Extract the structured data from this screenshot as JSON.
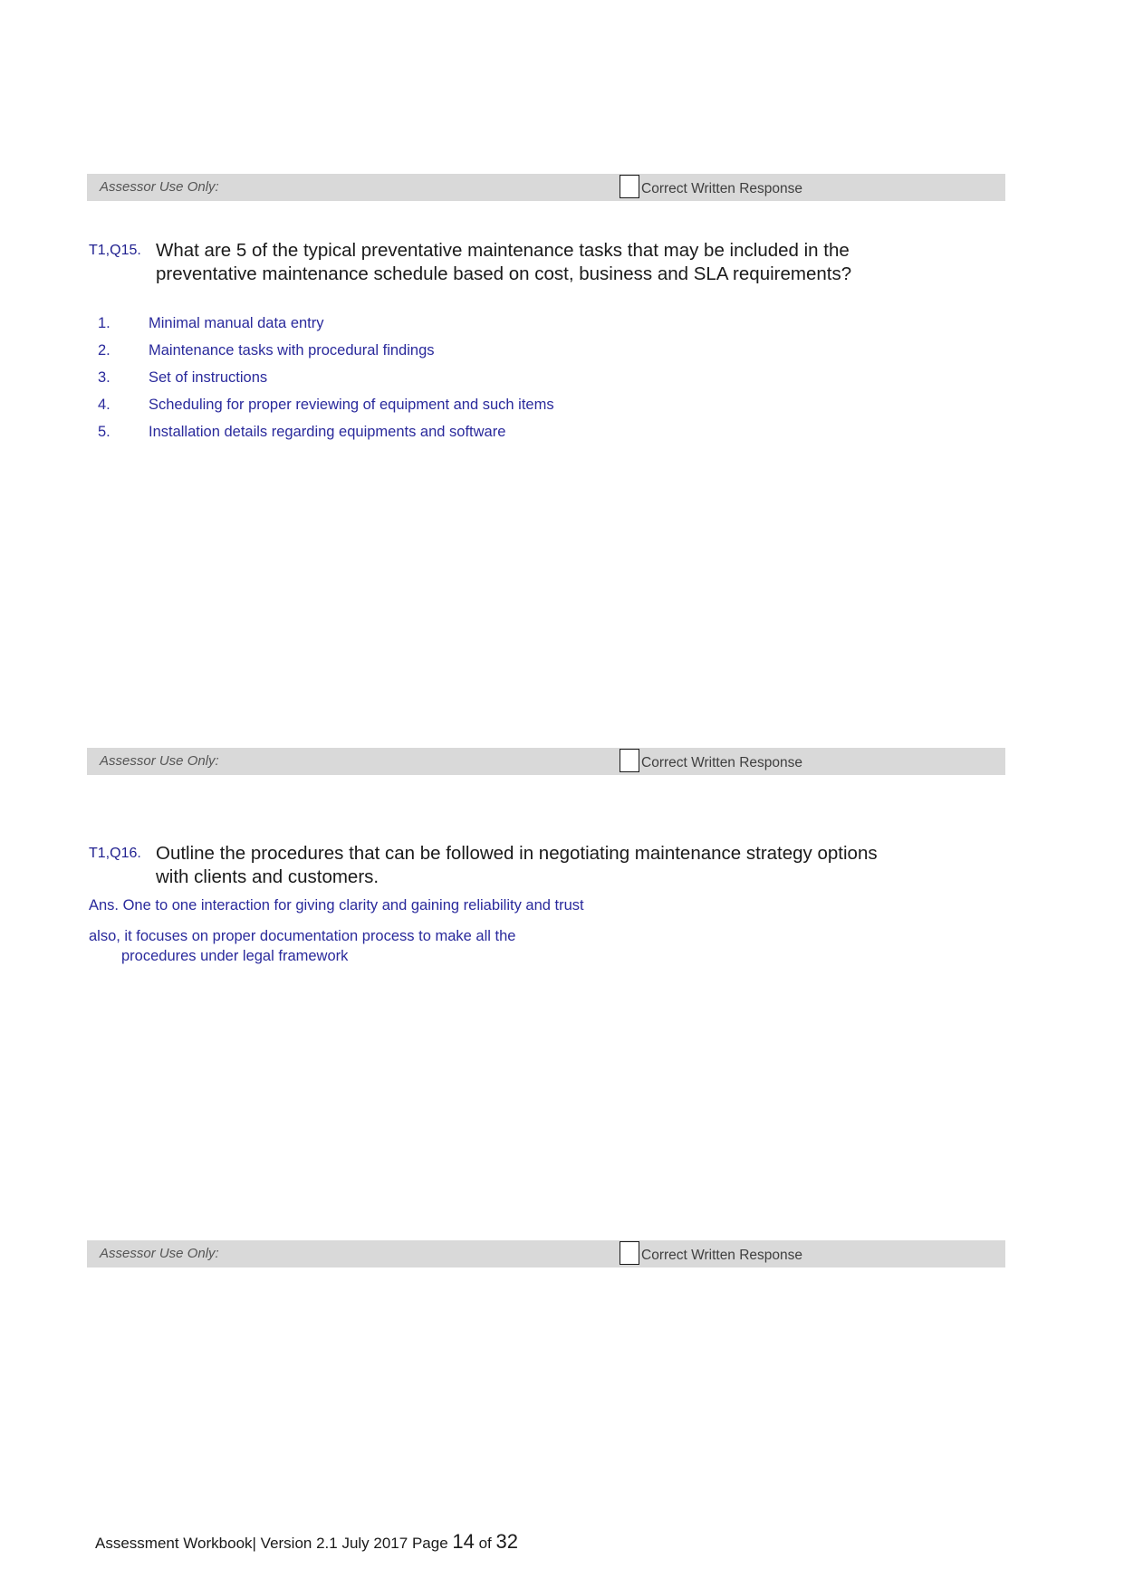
{
  "document": {
    "footer": {
      "prefix": "Assessment Workbook| Version 2.1 July 2017 Page ",
      "page_number": "14",
      "middle": " of ",
      "total_pages": "32"
    }
  },
  "assessor_bars": {
    "label": "Assessor Use Only:",
    "checkbox_label": "Correct Written Response"
  },
  "questions": [
    {
      "tag": "T1,Q15.",
      "text": "What are 5 of the typical preventative maintenance tasks that may be included in the preventative maintenance schedule based on cost, business and SLA requirements?",
      "answers": [
        {
          "num": "1.",
          "text": "Minimal manual data entry"
        },
        {
          "num": "2.",
          "text": "Maintenance tasks with procedural findings"
        },
        {
          "num": "3.",
          "text": "Set of instructions"
        },
        {
          "num": "4.",
          "text": "Scheduling for proper reviewing of equipment and such items"
        },
        {
          "num": "5.",
          "text": "Installation details regarding equipments and software"
        }
      ]
    },
    {
      "tag": "T1,Q16.",
      "text": "Outline the procedures that can be followed in negotiating maintenance strategy options with clients and customers.",
      "answer_line1": "Ans. One to one interaction for giving clarity and gaining reliability and trust",
      "answer_line2": "also, it focuses on proper documentation process to make all the",
      "answer_line3": "procedures under legal framework"
    }
  ],
  "colors": {
    "bar_background": "#d9d9d9",
    "question_tag": "#1f1f8f",
    "answer_text": "#2a2a9c",
    "body_text": "#1a1a1a"
  }
}
